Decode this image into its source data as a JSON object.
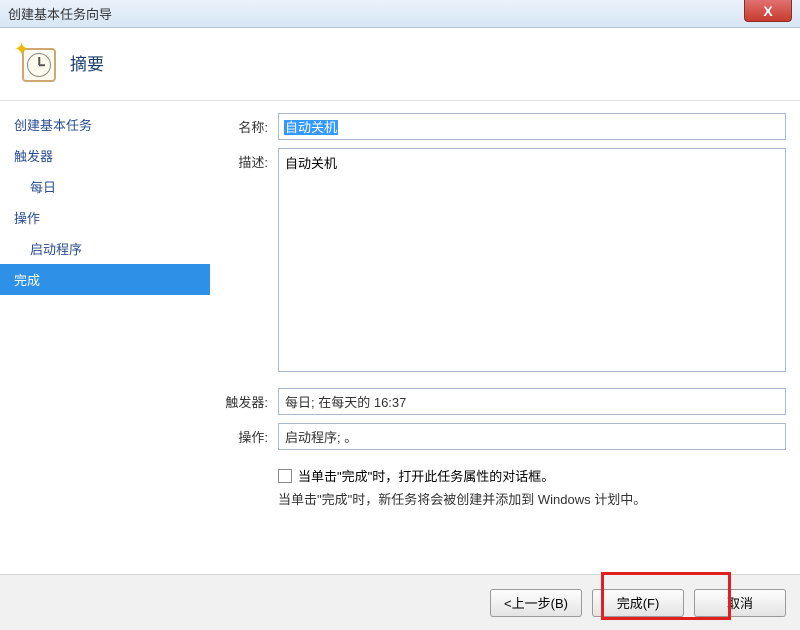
{
  "window": {
    "title": "创建基本任务向导",
    "close_label": "X"
  },
  "header": {
    "title": "摘要"
  },
  "sidebar": {
    "items": [
      {
        "label": "创建基本任务",
        "indent": 0,
        "selected": false
      },
      {
        "label": "触发器",
        "indent": 0,
        "selected": false
      },
      {
        "label": "每日",
        "indent": 1,
        "selected": false
      },
      {
        "label": "操作",
        "indent": 0,
        "selected": false
      },
      {
        "label": "启动程序",
        "indent": 1,
        "selected": false
      },
      {
        "label": "完成",
        "indent": 0,
        "selected": true
      }
    ]
  },
  "form": {
    "name_label": "名称:",
    "name_value": "自动关机",
    "desc_label": "描述:",
    "desc_value": "自动关机",
    "trigger_label": "触发器:",
    "trigger_value": "每日; 在每天的 16:37",
    "action_label": "操作:",
    "action_value": "启动程序; 。",
    "checkbox_label": "当单击\"完成\"时，打开此任务属性的对话框。",
    "note": "当单击\"完成\"时，新任务将会被创建并添加到 Windows 计划中。"
  },
  "buttons": {
    "back": "<上一步(B)",
    "finish": "完成(F)",
    "cancel": "取消"
  }
}
